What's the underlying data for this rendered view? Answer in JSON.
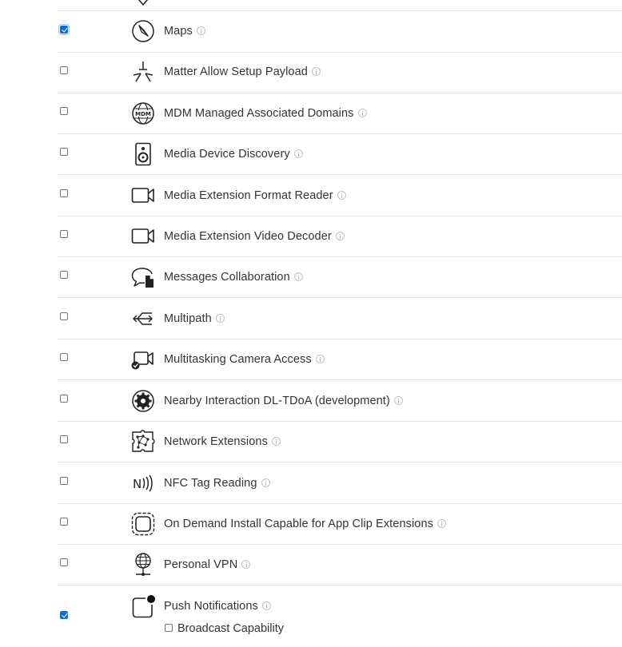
{
  "capabilities": [
    {
      "label": "Maps",
      "checked": true,
      "icon": "compass-icon"
    },
    {
      "label": "Matter Allow Setup Payload",
      "checked": false,
      "icon": "matter-icon"
    },
    {
      "label": "MDM Managed Associated Domains",
      "checked": false,
      "icon": "mdm-globe-icon",
      "icon_text": "MDM"
    },
    {
      "label": "Media Device Discovery",
      "checked": false,
      "icon": "speaker-icon"
    },
    {
      "label": "Media Extension Format Reader",
      "checked": false,
      "icon": "video-camera-icon"
    },
    {
      "label": "Media Extension Video Decoder",
      "checked": false,
      "icon": "video-camera-icon"
    },
    {
      "label": "Messages Collaboration",
      "checked": false,
      "icon": "message-document-icon"
    },
    {
      "label": "Multipath",
      "checked": false,
      "icon": "multipath-arrows-icon"
    },
    {
      "label": "Multitasking Camera Access",
      "checked": false,
      "icon": "camera-check-icon"
    },
    {
      "label": "Nearby Interaction DL-TDoA (development)",
      "checked": false,
      "icon": "gear-icon"
    },
    {
      "label": "Network Extensions",
      "checked": false,
      "icon": "network-puzzle-icon"
    },
    {
      "label": "NFC Tag Reading",
      "checked": false,
      "icon": "nfc-icon",
      "icon_text": "N"
    },
    {
      "label": "On Demand Install Capable for App Clip Extensions",
      "checked": false,
      "icon": "app-clip-icon"
    },
    {
      "label": "Personal VPN",
      "checked": false,
      "icon": "vpn-globe-icon"
    },
    {
      "label": "Push Notifications",
      "checked": true,
      "icon": "push-notification-icon",
      "sub_options": [
        {
          "label": "Broadcast Capability",
          "checked": false
        }
      ]
    }
  ]
}
